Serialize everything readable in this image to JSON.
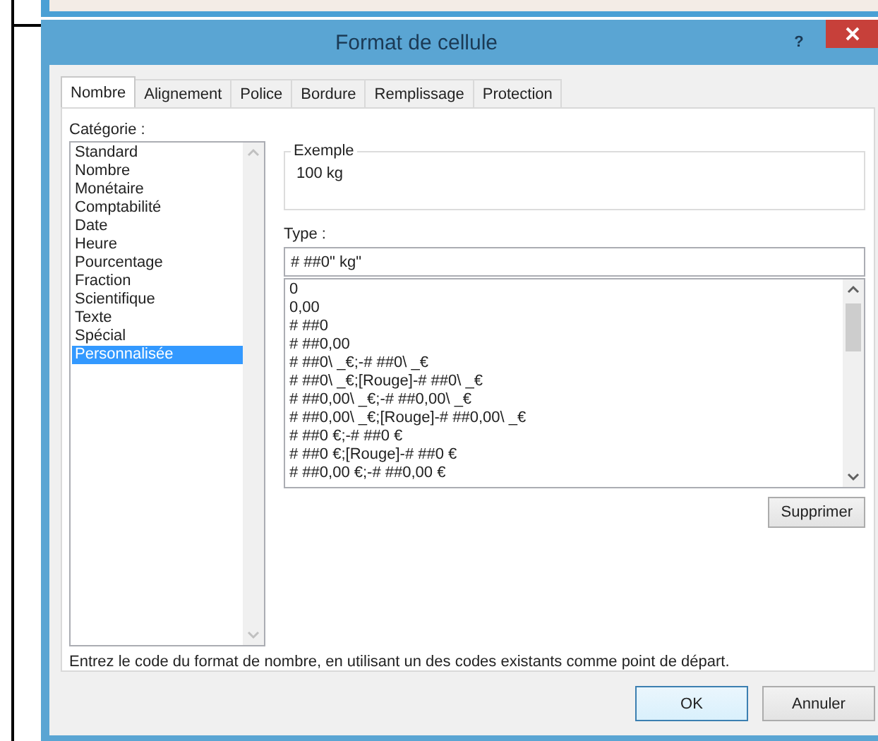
{
  "window": {
    "title": "Format de cellule",
    "help": "?"
  },
  "tabs": [
    {
      "label": "Nombre",
      "selected": true
    },
    {
      "label": "Alignement",
      "selected": false
    },
    {
      "label": "Police",
      "selected": false
    },
    {
      "label": "Bordure",
      "selected": false
    },
    {
      "label": "Remplissage",
      "selected": false
    },
    {
      "label": "Protection",
      "selected": false
    }
  ],
  "category": {
    "label": "Catégorie :",
    "items": [
      {
        "label": "Standard",
        "selected": false
      },
      {
        "label": "Nombre",
        "selected": false
      },
      {
        "label": "Monétaire",
        "selected": false
      },
      {
        "label": "Comptabilité",
        "selected": false
      },
      {
        "label": "Date",
        "selected": false
      },
      {
        "label": "Heure",
        "selected": false
      },
      {
        "label": "Pourcentage",
        "selected": false
      },
      {
        "label": "Fraction",
        "selected": false
      },
      {
        "label": "Scientifique",
        "selected": false
      },
      {
        "label": "Texte",
        "selected": false
      },
      {
        "label": "Spécial",
        "selected": false
      },
      {
        "label": "Personnalisée",
        "selected": true
      }
    ]
  },
  "example": {
    "legend": "Exemple",
    "value": "100 kg"
  },
  "type": {
    "label": "Type :",
    "value": "# ##0\" kg\"",
    "formats": [
      "0",
      "0,00",
      "# ##0",
      "# ##0,00",
      "# ##0\\ _€;-# ##0\\ _€",
      "# ##0\\ _€;[Rouge]-# ##0\\ _€",
      "# ##0,00\\ _€;-# ##0,00\\ _€",
      "# ##0,00\\ _€;[Rouge]-# ##0,00\\ _€",
      "# ##0 €;-# ##0 €",
      "# ##0 €;[Rouge]-# ##0 €",
      "# ##0,00 €;-# ##0,00 €"
    ]
  },
  "delete_button": "Supprimer",
  "hint": "Entrez le code du format de nombre, en utilisant un des codes existants comme point de départ.",
  "buttons": [
    {
      "label": "OK",
      "default": true
    },
    {
      "label": "Annuler",
      "default": false
    }
  ]
}
